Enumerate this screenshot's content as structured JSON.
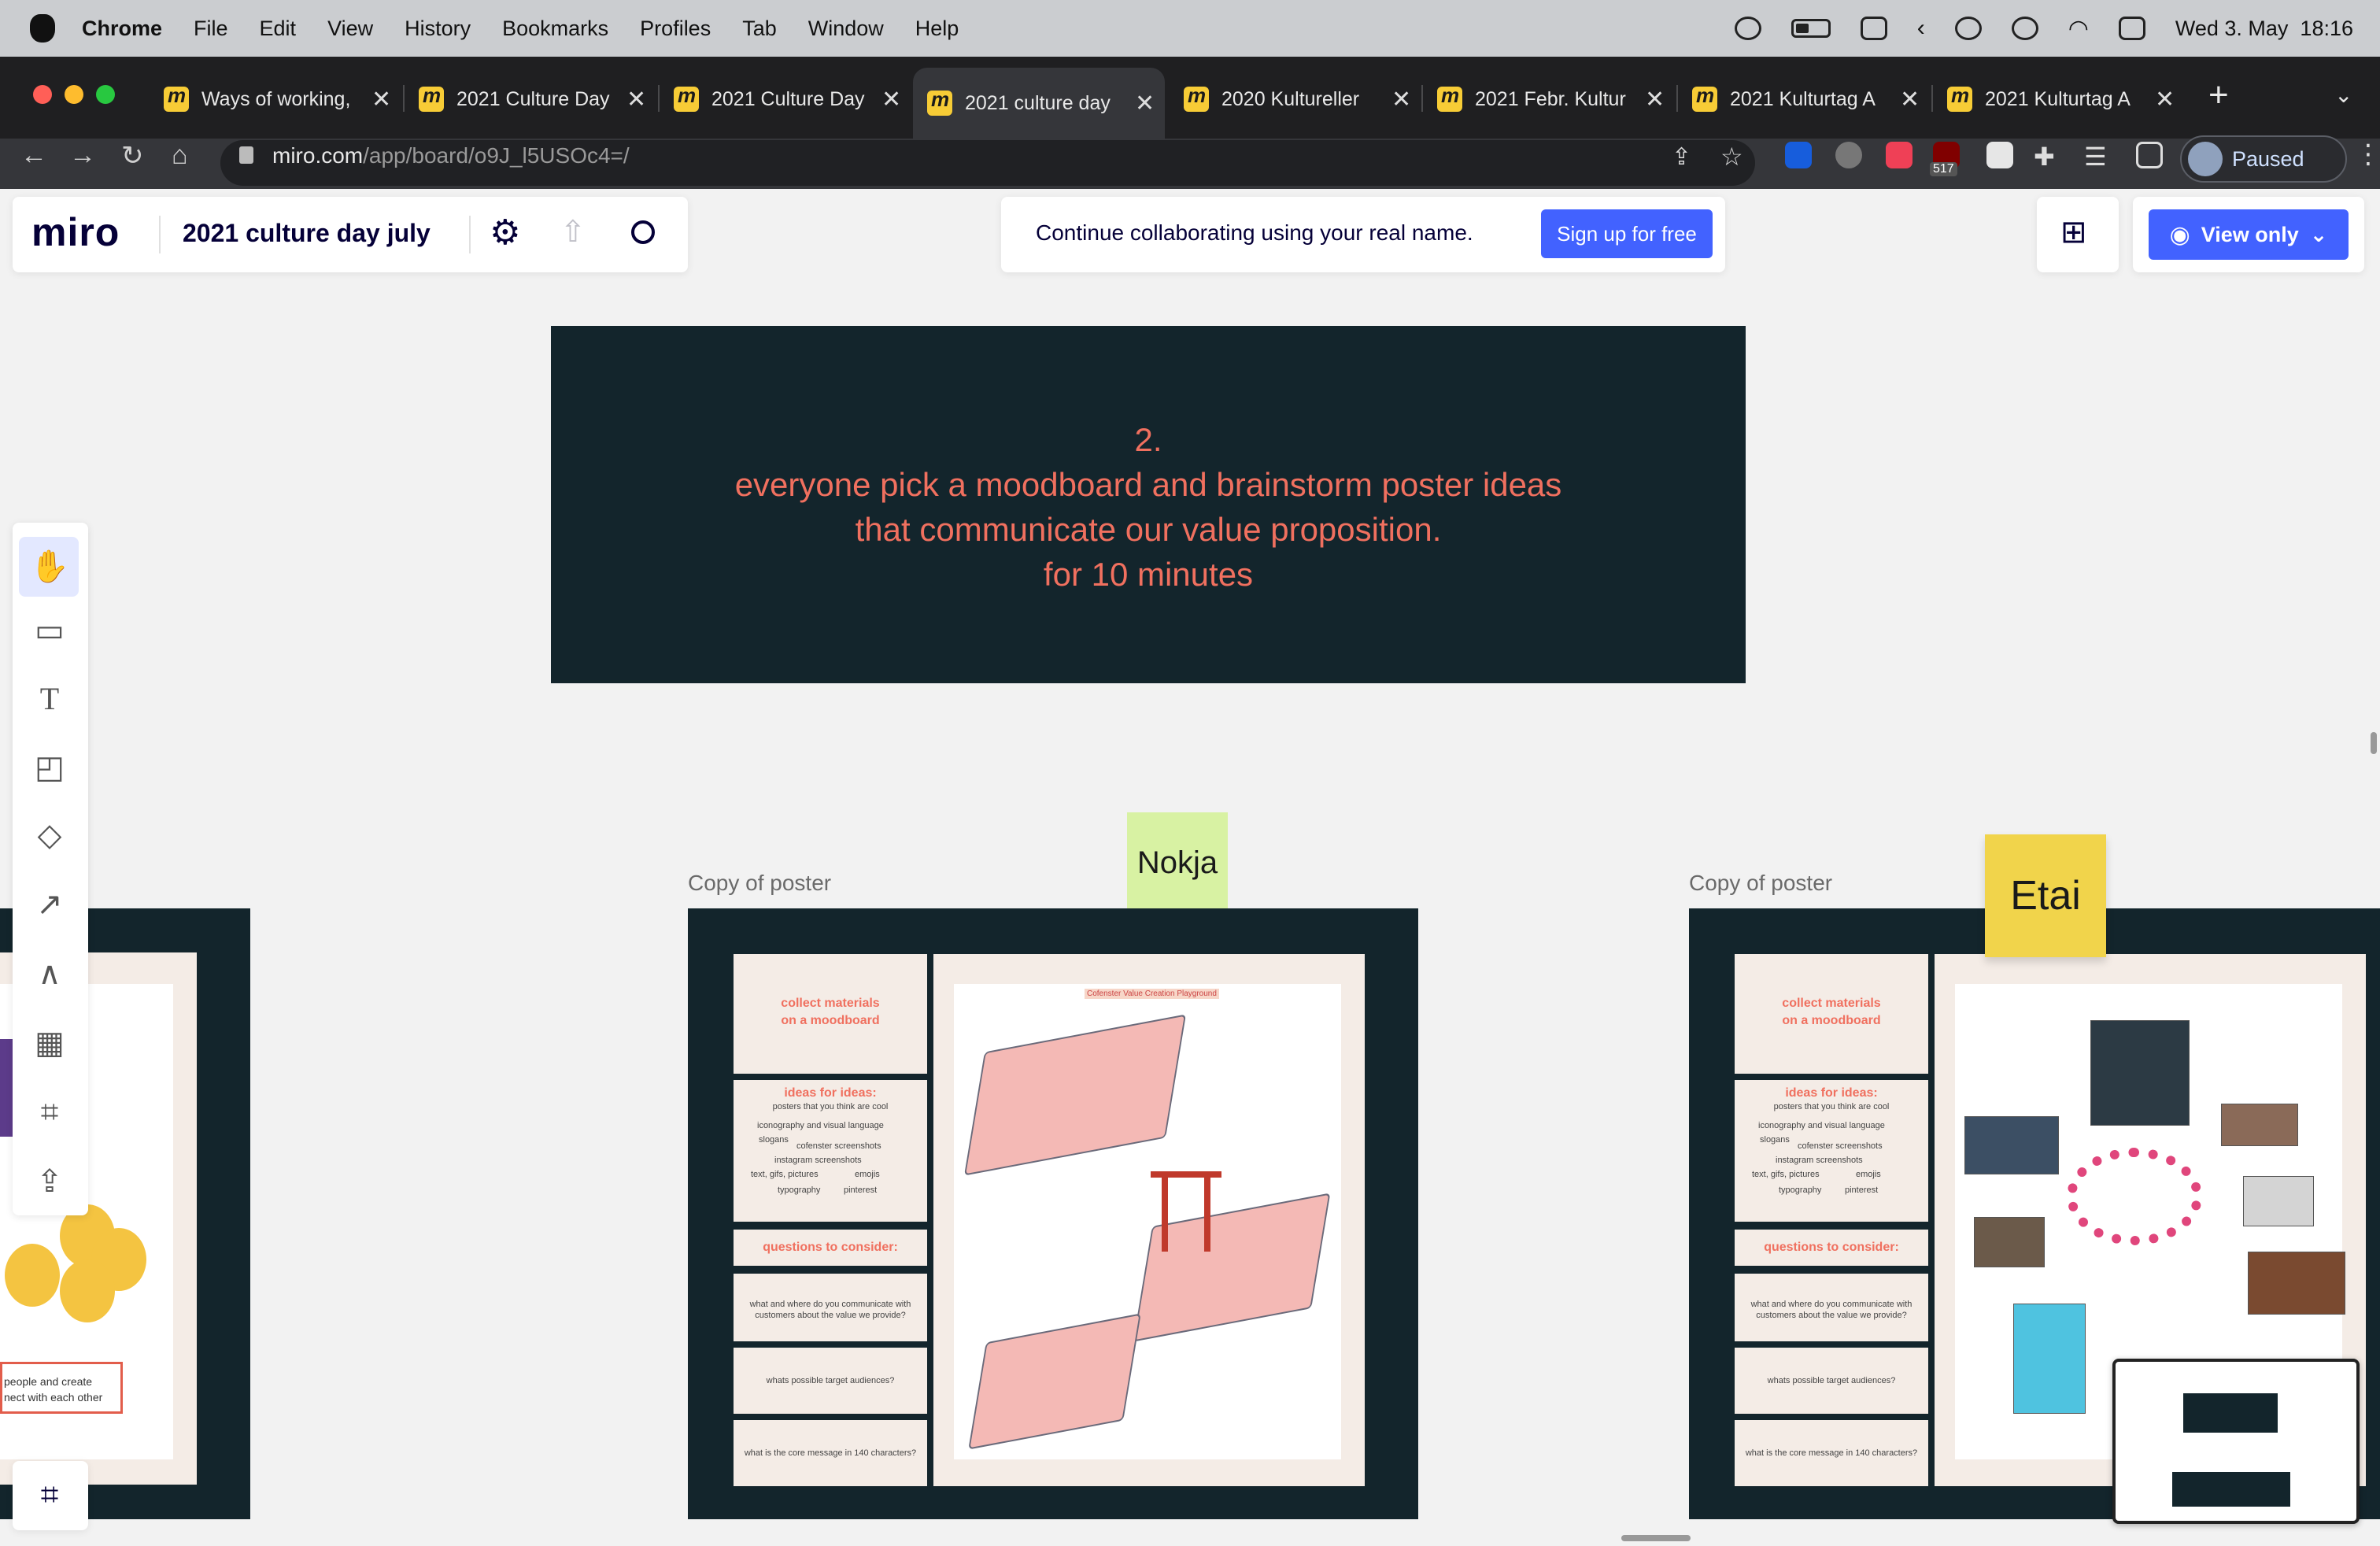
{
  "menubar": {
    "app": "Chrome",
    "items": [
      "File",
      "Edit",
      "View",
      "History",
      "Bookmarks",
      "Profiles",
      "Tab",
      "Window",
      "Help"
    ],
    "clock": "Wed 3. May  18:16"
  },
  "browser": {
    "tabs": [
      {
        "label": "Ways of working,",
        "active": false
      },
      {
        "label": "2021 Culture Day",
        "active": false
      },
      {
        "label": "2021 Culture Day",
        "active": false
      },
      {
        "label": "2021 culture day",
        "active": true
      },
      {
        "label": "2020 Kultureller",
        "active": false
      },
      {
        "label": "2021 Febr. Kultur",
        "active": false
      },
      {
        "label": "2021 Kulturtag A",
        "active": false
      },
      {
        "label": "2021 Kulturtag A",
        "active": false
      }
    ],
    "url_host": "miro.com",
    "url_path": "/app/board/o9J_l5USOc4=/",
    "profile_label": "Paused",
    "extension_badge": "517"
  },
  "miro": {
    "logo": "miro",
    "board_name": "2021 culture day july",
    "collab_prompt": "Continue collaborating using your real name.",
    "signup_label": "Sign up for free",
    "view_only_label": "View only"
  },
  "canvas": {
    "instruction_lines": [
      "2.",
      "everyone pick a moodboard and brainstorm poster ideas",
      "that communicate our value proposition.",
      "for 10 minutes"
    ],
    "frames": [
      {
        "label": "Copy of poster",
        "sticky": "Nokja",
        "sticky_color": "#d8f2a3"
      },
      {
        "label": "Copy of poster",
        "sticky": "Etai",
        "sticky_color": "#f1d44b"
      }
    ],
    "poster": {
      "collect": "collect materials\non a moodboard",
      "ideas_title": "ideas for ideas:",
      "ideas_sub": "posters that you think are cool",
      "ideas_items": [
        "iconography and visual language",
        "slogans",
        "cofenster screenshots",
        "instagram screenshots",
        "text, gifs, pictures",
        "emojis",
        "typography",
        "pinterest"
      ],
      "questions_title": "questions to consider:",
      "q1": "what and where do you communicate with customers about the value we provide?",
      "q2": "whats possible target audiences?",
      "q3": "what is the core message in 140 characters?",
      "illustration_title": "Cofenster Value Creation Playground"
    },
    "left_partial_text": "people and create\nnect with each other"
  },
  "colors": {
    "accent": "#4262ff",
    "dark_frame": "#13252c",
    "coral": "#f0705f"
  }
}
